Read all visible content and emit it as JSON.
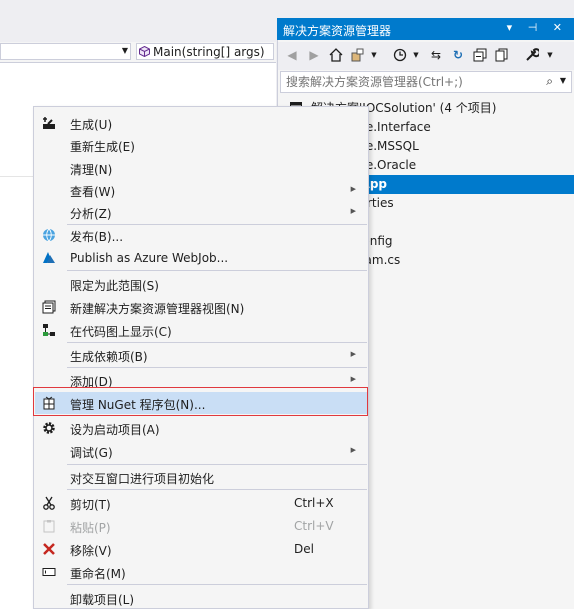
{
  "editor": {
    "method_combo": "Main(string[] args)"
  },
  "solution_explorer": {
    "title": "解决方案资源管理器",
    "title_buttons": "▾ ⊣ ✕",
    "search_placeholder": "搜索解决方案资源管理器(Ctrl+;)",
    "tree": [
      {
        "text": "解决方案'IOCSolution' (4 个项目)",
        "selected": false
      },
      {
        "text": "use.Interface",
        "selected": false
      },
      {
        "text": "use.MSSQL",
        "selected": false
      },
      {
        "text": "use.Oracle",
        "selected": false
      },
      {
        "text": "nApp",
        "selected": true
      },
      {
        "text": "perties",
        "selected": false
      },
      {
        "text": "",
        "selected": false
      },
      {
        "text": ".config",
        "selected": false
      },
      {
        "text": "gram.cs",
        "selected": false
      }
    ]
  },
  "context_menu": {
    "items": [
      {
        "label": "生成(U)",
        "icon": "build-icon",
        "shortcut": "",
        "submenu": false,
        "disabled": false
      },
      {
        "label": "重新生成(E)",
        "icon": "",
        "shortcut": "",
        "submenu": false,
        "disabled": false
      },
      {
        "label": "清理(N)",
        "icon": "",
        "shortcut": "",
        "submenu": false,
        "disabled": false
      },
      {
        "label": "查看(W)",
        "icon": "",
        "shortcut": "",
        "submenu": true,
        "disabled": false
      },
      {
        "label": "分析(Z)",
        "icon": "",
        "shortcut": "",
        "submenu": true,
        "disabled": false
      },
      {
        "label": "发布(B)...",
        "icon": "globe-icon",
        "shortcut": "",
        "submenu": false,
        "disabled": false
      },
      {
        "label": "Publish as Azure WebJob...",
        "icon": "azure-icon",
        "shortcut": "",
        "submenu": false,
        "disabled": false
      },
      {
        "label": "限定为此范围(S)",
        "icon": "",
        "shortcut": "",
        "submenu": false,
        "disabled": false
      },
      {
        "label": "新建解决方案资源管理器视图(N)",
        "icon": "new-view-icon",
        "shortcut": "",
        "submenu": false,
        "disabled": false
      },
      {
        "label": "在代码图上显示(C)",
        "icon": "code-map-icon",
        "shortcut": "",
        "submenu": false,
        "disabled": false
      },
      {
        "label": "生成依赖项(B)",
        "icon": "",
        "shortcut": "",
        "submenu": true,
        "disabled": false
      },
      {
        "label": "添加(D)",
        "icon": "",
        "shortcut": "",
        "submenu": true,
        "disabled": false
      },
      {
        "label": "管理 NuGet 程序包(N)...",
        "icon": "nuget-icon",
        "shortcut": "",
        "submenu": false,
        "disabled": false
      },
      {
        "label": "设为启动项目(A)",
        "icon": "gear-icon",
        "shortcut": "",
        "submenu": false,
        "disabled": false
      },
      {
        "label": "调试(G)",
        "icon": "",
        "shortcut": "",
        "submenu": true,
        "disabled": false
      },
      {
        "label": "对交互窗口进行项目初始化",
        "icon": "",
        "shortcut": "",
        "submenu": false,
        "disabled": false
      },
      {
        "label": "剪切(T)",
        "icon": "scissors-icon",
        "shortcut": "Ctrl+X",
        "submenu": false,
        "disabled": false
      },
      {
        "label": "粘贴(P)",
        "icon": "paste-icon",
        "shortcut": "Ctrl+V",
        "submenu": false,
        "disabled": true
      },
      {
        "label": "移除(V)",
        "icon": "remove-icon",
        "shortcut": "Del",
        "submenu": false,
        "disabled": false
      },
      {
        "label": "重命名(M)",
        "icon": "rename-icon",
        "shortcut": "",
        "submenu": false,
        "disabled": false
      },
      {
        "label": "卸载项目(L)",
        "icon": "",
        "shortcut": "",
        "submenu": false,
        "disabled": false
      }
    ]
  },
  "colors": {
    "accent": "#007acc",
    "highlight": "#c9def5",
    "callout_border": "#e0393e"
  }
}
